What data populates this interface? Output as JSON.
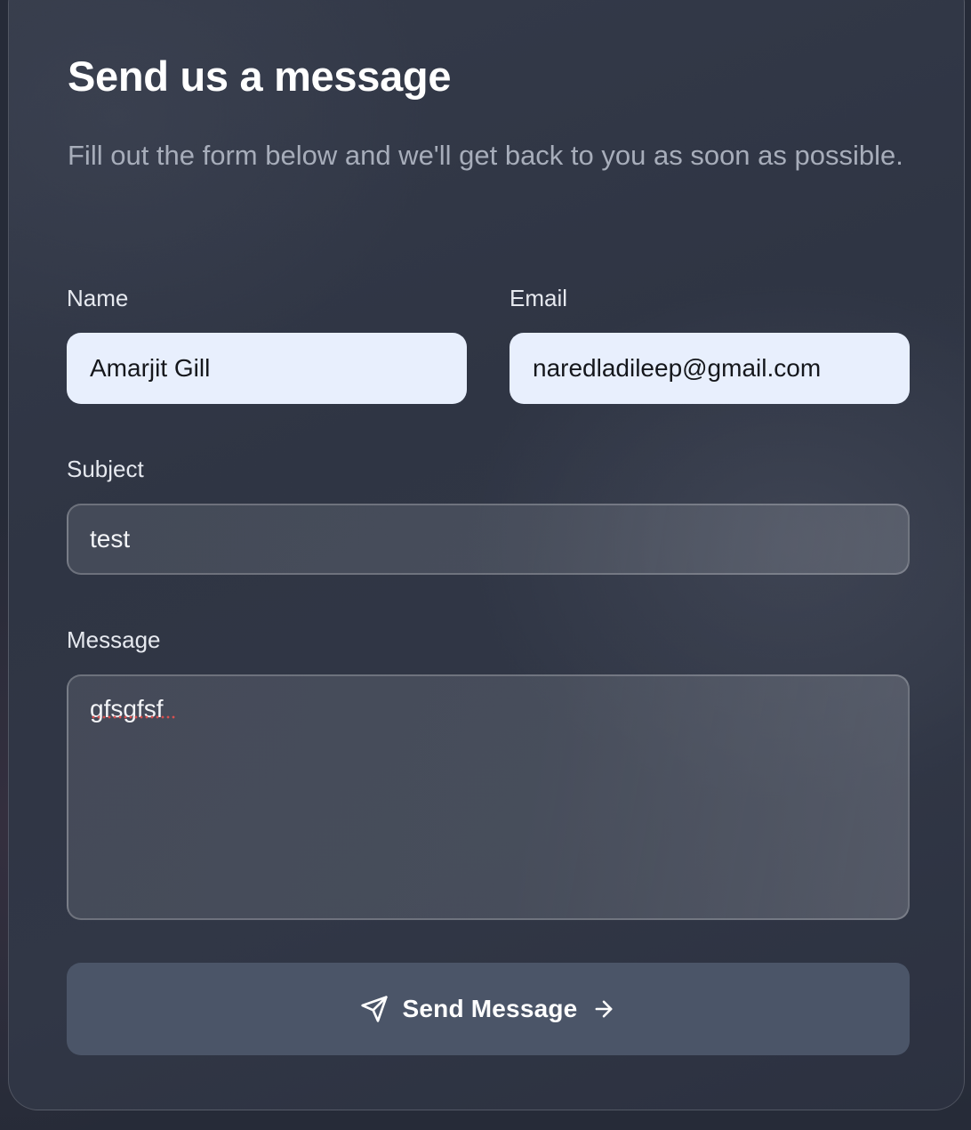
{
  "form": {
    "title": "Send us a message",
    "subtitle": "Fill out the form below and we'll get back to you as soon as possible.",
    "name_label": "Name",
    "name_value": "Amarjit Gill",
    "email_label": "Email",
    "email_value": "naredladileep@gmail.com",
    "subject_label": "Subject",
    "subject_value": "test",
    "message_label": "Message",
    "message_value": "gfsgfsf",
    "submit_label": "Send Message",
    "submit_leading_icon": "send-icon",
    "submit_trailing_icon": "arrow-right-icon"
  },
  "colors": {
    "card_background": "#313746",
    "filled_input_background": "#e8effd",
    "button_background": "#4b5568",
    "title_text": "#ffffff",
    "subtitle_text": "#a7adba"
  }
}
